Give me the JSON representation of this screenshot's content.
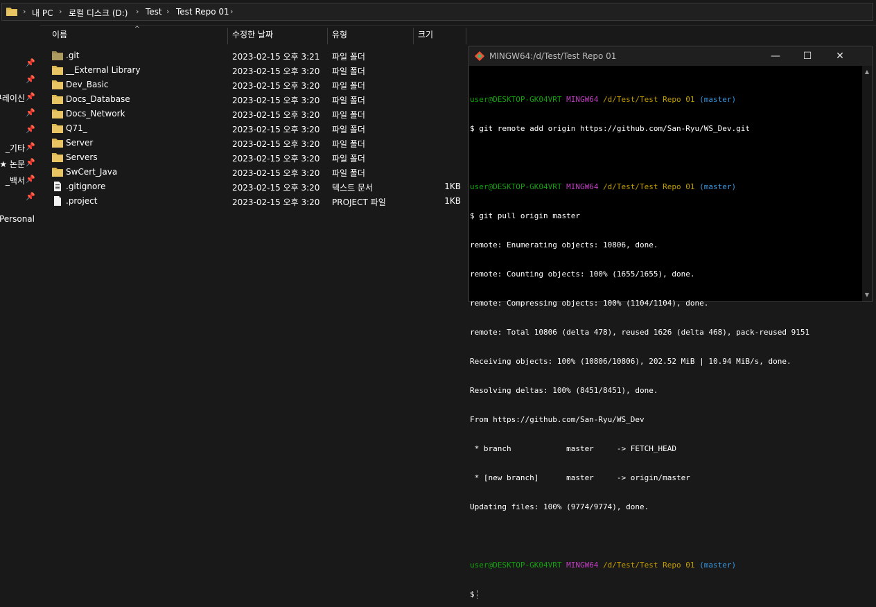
{
  "addressbar": {
    "crumbs": [
      "내 PC",
      "로컬 디스크 (D:)",
      "Test",
      "Test Repo 01"
    ],
    "separator": "›"
  },
  "navpane": {
    "items": [
      {
        "label": "",
        "pinned": true
      },
      {
        "label": "",
        "pinned": true
      },
      {
        "label": "쿠레이신",
        "pinned": true
      },
      {
        "label": "",
        "pinned": true
      },
      {
        "label": "",
        "pinned": true
      },
      {
        "label": "_기타",
        "pinned": true
      },
      {
        "label": "_★ 논문",
        "pinned": true
      },
      {
        "label": "_백서",
        "pinned": true
      },
      {
        "label": "",
        "pinned": true
      },
      {
        "label": "Personal",
        "pinned": false
      }
    ],
    "pin_glyph": "📌"
  },
  "columns": {
    "name": "이름",
    "date": "수정한 날짜",
    "type": "유형",
    "size": "크기",
    "sort_caret": "^"
  },
  "files": [
    {
      "name": ".git",
      "date": "2023-02-15 오후 3:21",
      "type": "파일 폴더",
      "size": "",
      "kind": "folder-dim"
    },
    {
      "name": "__External Library",
      "date": "2023-02-15 오후 3:20",
      "type": "파일 폴더",
      "size": "",
      "kind": "folder"
    },
    {
      "name": "Dev_Basic",
      "date": "2023-02-15 오후 3:20",
      "type": "파일 폴더",
      "size": "",
      "kind": "folder"
    },
    {
      "name": "Docs_Database",
      "date": "2023-02-15 오후 3:20",
      "type": "파일 폴더",
      "size": "",
      "kind": "folder"
    },
    {
      "name": "Docs_Network",
      "date": "2023-02-15 오후 3:20",
      "type": "파일 폴더",
      "size": "",
      "kind": "folder"
    },
    {
      "name": "Q71_",
      "date": "2023-02-15 오후 3:20",
      "type": "파일 폴더",
      "size": "",
      "kind": "folder"
    },
    {
      "name": "Server",
      "date": "2023-02-15 오후 3:20",
      "type": "파일 폴더",
      "size": "",
      "kind": "folder"
    },
    {
      "name": "Servers",
      "date": "2023-02-15 오후 3:20",
      "type": "파일 폴더",
      "size": "",
      "kind": "folder"
    },
    {
      "name": "SwCert_Java",
      "date": "2023-02-15 오후 3:20",
      "type": "파일 폴더",
      "size": "",
      "kind": "folder"
    },
    {
      "name": ".gitignore",
      "date": "2023-02-15 오후 3:20",
      "type": "텍스트 문서",
      "size": "1KB",
      "kind": "text"
    },
    {
      "name": ".project",
      "date": "2023-02-15 오후 3:20",
      "type": "PROJECT 파일",
      "size": "1KB",
      "kind": "file"
    }
  ],
  "terminal": {
    "title": "MINGW64:/d/Test/Test Repo 01",
    "window_buttons": {
      "minimize": "—",
      "maximize": "☐",
      "close": "✕"
    },
    "prompt": {
      "user": "user@DESKTOP-GK04VRT",
      "env": "MINGW64",
      "path": "/d/Test/Test Repo 01",
      "branch": "(master)"
    },
    "lines": [
      {
        "kind": "prompt"
      },
      {
        "kind": "text",
        "text": "$ git remote add origin https://github.com/San-Ryu/WS_Dev.git"
      },
      {
        "kind": "blank"
      },
      {
        "kind": "prompt"
      },
      {
        "kind": "text",
        "text": "$ git pull origin master"
      },
      {
        "kind": "text",
        "text": "remote: Enumerating objects: 10806, done."
      },
      {
        "kind": "text",
        "text": "remote: Counting objects: 100% (1655/1655), done."
      },
      {
        "kind": "text",
        "text": "remote: Compressing objects: 100% (1104/1104), done."
      },
      {
        "kind": "text",
        "text": "remote: Total 10806 (delta 478), reused 1626 (delta 468), pack-reused 9151"
      },
      {
        "kind": "text",
        "text": "Receiving objects: 100% (10806/10806), 202.52 MiB | 10.94 MiB/s, done."
      },
      {
        "kind": "text",
        "text": "Resolving deltas: 100% (8451/8451), done."
      },
      {
        "kind": "text",
        "text": "From https://github.com/San-Ryu/WS_Dev"
      },
      {
        "kind": "text",
        "text": " * branch            master     -> FETCH_HEAD"
      },
      {
        "kind": "text",
        "text": " * [new branch]      master     -> origin/master"
      },
      {
        "kind": "text",
        "text": "Updating files: 100% (9774/9774), done."
      },
      {
        "kind": "blank"
      },
      {
        "kind": "prompt"
      },
      {
        "kind": "input",
        "text": "$"
      }
    ],
    "scroll_up": "▲",
    "scroll_down": "▼"
  },
  "colors": {
    "background": "#191919",
    "folder": "#dcb84f",
    "folder_dim": "#9c8a52",
    "prompt_user": "#13a10e",
    "prompt_env": "#bf40bf",
    "prompt_path": "#c19c00",
    "prompt_branch": "#3a96dd"
  }
}
